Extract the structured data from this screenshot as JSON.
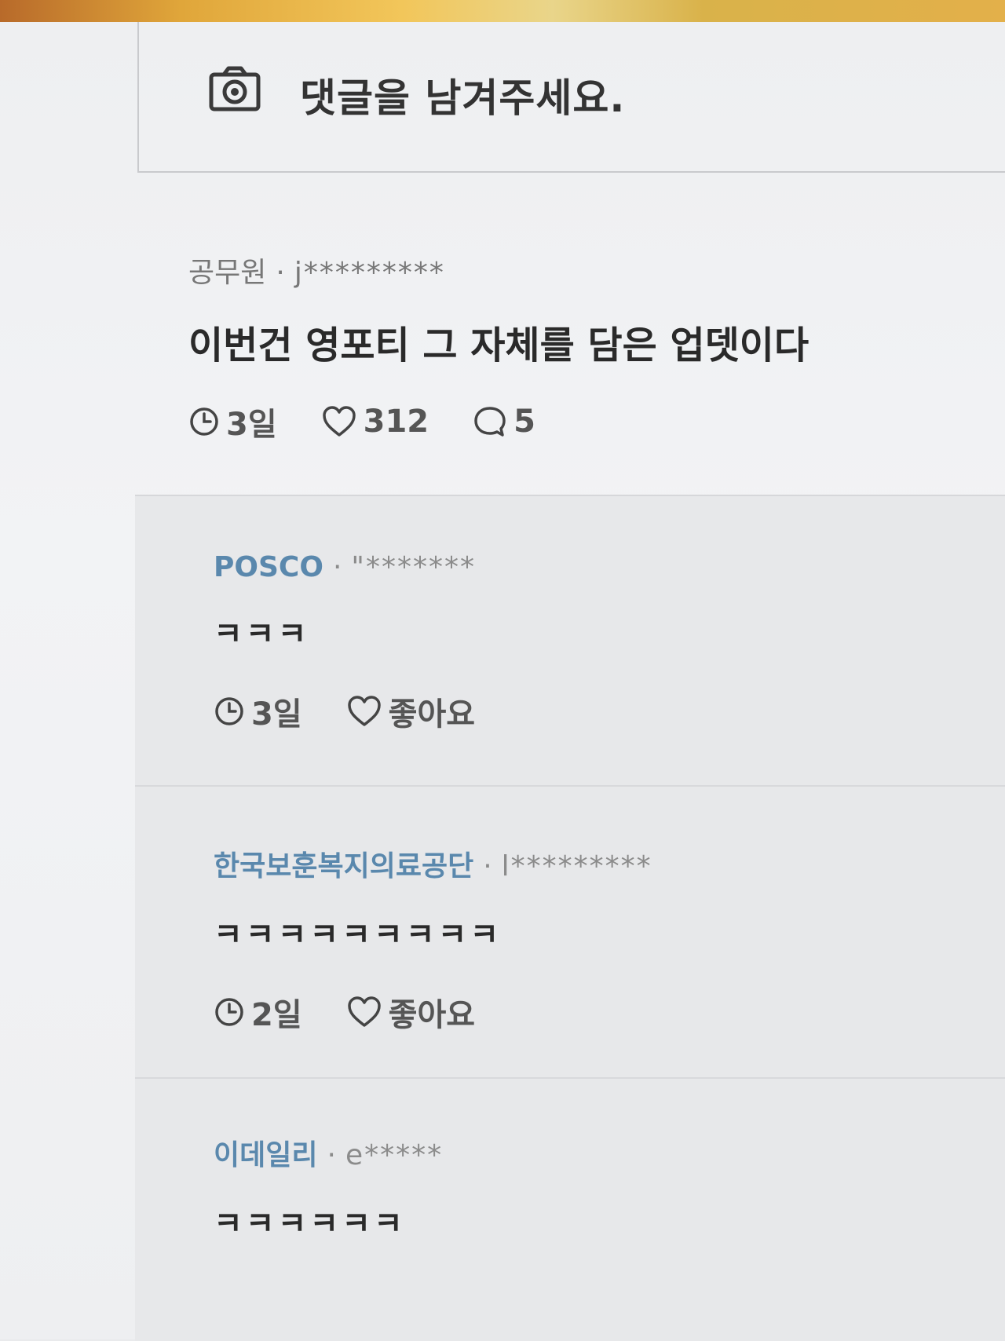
{
  "composer": {
    "placeholder": "댓글을 남겨주세요."
  },
  "comment": {
    "company": "공무원",
    "separator": "·",
    "user": "j*********",
    "text": "이번건 영포티 그 자체를 담은 업뎃이다",
    "time": "3일",
    "likes": "312",
    "replies": "5"
  },
  "replies": [
    {
      "company": "POSCO",
      "separator": "·",
      "user": "\"*******",
      "text": "ㅋㅋㅋ",
      "time": "3일",
      "like_label": "좋아요"
    },
    {
      "company": "한국보훈복지의료공단",
      "separator": "·",
      "user": "l*********",
      "text": "ㅋㅋㅋㅋㅋㅋㅋㅋㅋ",
      "time": "2일",
      "like_label": "좋아요"
    },
    {
      "company": "이데일리",
      "separator": "·",
      "user": "e*****",
      "text": "ㅋㅋㅋㅋㅋㅋ"
    }
  ],
  "icons": {
    "camera": "camera-icon",
    "clock": "clock-icon",
    "heart": "heart-icon",
    "comment": "comment-icon"
  }
}
